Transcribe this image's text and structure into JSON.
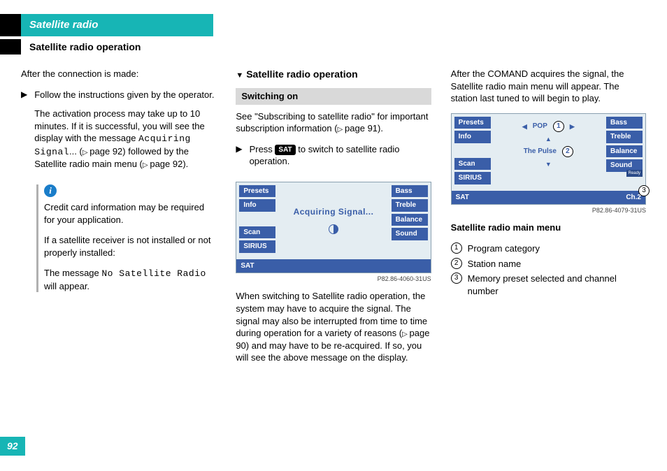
{
  "header": {
    "title": "Satellite radio",
    "subtitle": "Satellite radio operation"
  },
  "page_number": "92",
  "col1": {
    "intro": "After the connection is made:",
    "step1": "Follow the instructions given by the operator.",
    "step1_detail_a": "The activation process may take up to 10 minutes. If it is successful, you will see the display with the message ",
    "acq_text": "Acquiring Signal",
    "step1_detail_b": "... (",
    "step1_ref": "page 92",
    "step1_detail_c": ") followed by the Satellite radio main menu (",
    "step1_ref2": "page 92",
    "step1_detail_d": ").",
    "info_a": "Credit card information may be required for your application.",
    "info_b": "If a satellite receiver is not installed or not properly installed:",
    "info_c_a": "The message ",
    "info_c_mono": "No Satellite Radio",
    "info_c_b": " will appear."
  },
  "col2": {
    "heading": "Satellite radio operation",
    "sub": "Switching on",
    "see_a": "See \"Subscribing to satellite radio\" for important subscription information (",
    "see_ref": "page 91",
    "see_b": ").",
    "press_a": "Press ",
    "sat_pill": "SAT",
    "press_b": " to switch to satellite radio operation.",
    "panel": {
      "left": [
        "Presets",
        "Info",
        "",
        "Scan",
        "SIRIUS"
      ],
      "right": [
        "Bass",
        "Treble",
        "Balance",
        "Sound"
      ],
      "center": "Acquiring Signal...",
      "footer_left": "SAT",
      "footer_right": ""
    },
    "fig_id": "P82.86-4060-31US",
    "para_a": "When switching to Satellite radio operation, the system may have to acquire the signal. The signal may also be interrupted from time to time during operation for a variety of reasons (",
    "para_ref": "page 90",
    "para_b": ") and may have to be re-acquired. If so, you will see the above message on the display."
  },
  "col3": {
    "intro": "After the COMAND acquires the signal, the Satellite radio main menu will appear. The station last tuned to will begin to play.",
    "panel": {
      "left": [
        "Presets",
        "Info",
        "",
        "Scan",
        "SIRIUS"
      ],
      "right": [
        "Bass",
        "Treble",
        "Balance",
        "Sound"
      ],
      "pop": "POP",
      "station": "The Pulse",
      "footer_left": "SAT",
      "footer_right": "Ch.2",
      "ready": "Ready"
    },
    "fig_id": "P82.86-4079-31US",
    "caption": "Satellite radio main menu",
    "legend": {
      "c1": "1",
      "t1": "Program category",
      "c2": "2",
      "t2": "Station name",
      "c3": "3",
      "t3": "Memory preset selected and channel number"
    }
  }
}
